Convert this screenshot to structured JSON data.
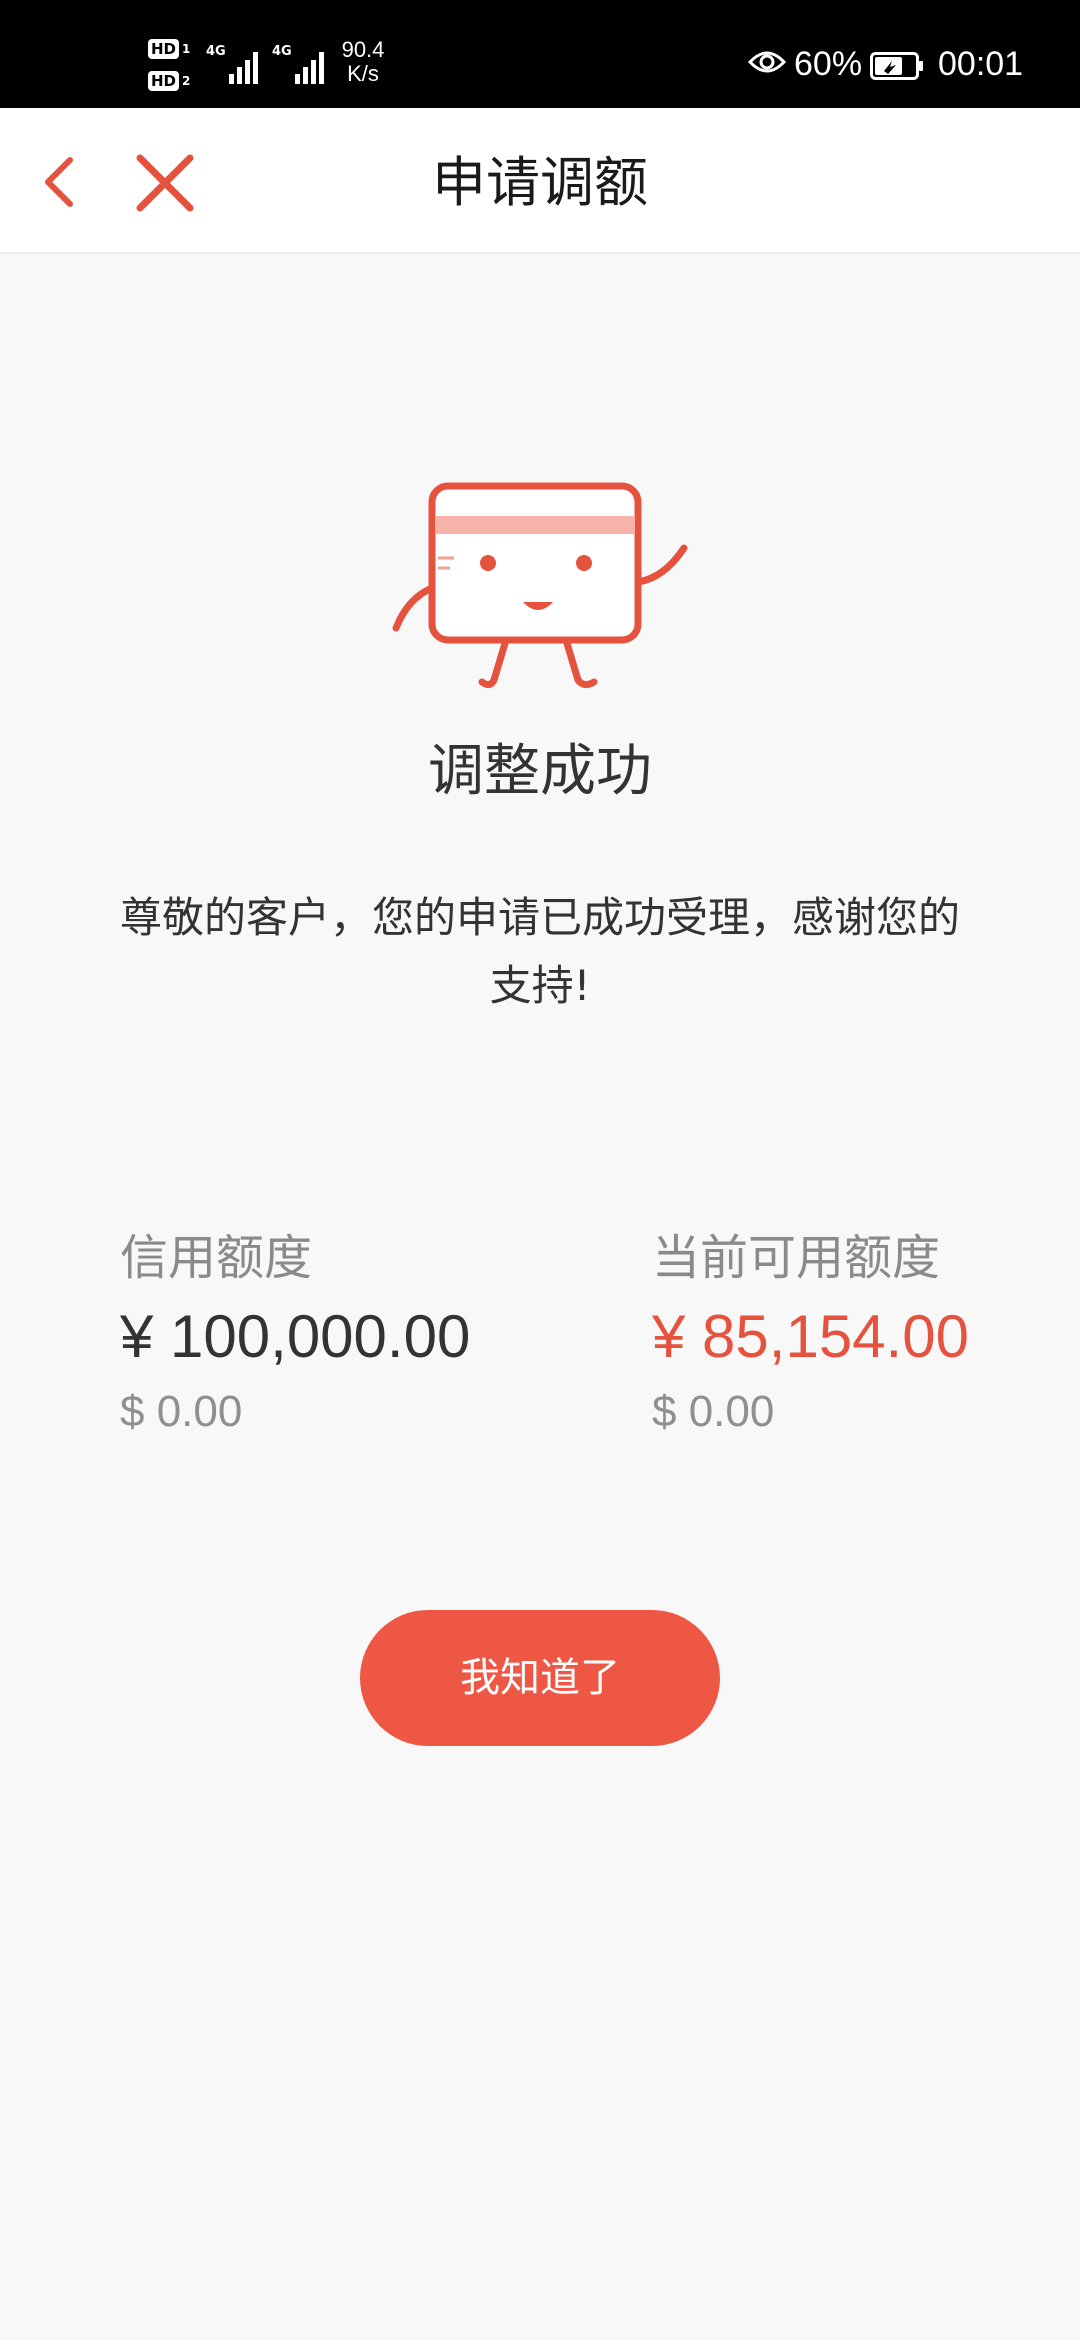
{
  "status_bar": {
    "sim1_badge": "HD",
    "sim1_index": "1",
    "sim2_badge": "HD",
    "sim2_index": "2",
    "network1": "4G",
    "network2": "4G",
    "speed_value": "90.4",
    "speed_unit": "K/s",
    "battery_percent": "60%",
    "time": "00:01",
    "icons": [
      "signal-icon",
      "eye-icon",
      "battery-icon"
    ]
  },
  "nav": {
    "title": "申请调额",
    "back_icon": "chevron-left-icon",
    "close_icon": "close-icon"
  },
  "result": {
    "illustration": "card-mascot-icon",
    "title": "调整成功",
    "message": "尊敬的客户，您的申请已成功受理，感谢您的支持!"
  },
  "limits": {
    "credit": {
      "label": "信用额度",
      "cny": "¥ 100,000.00",
      "usd": "$ 0.00"
    },
    "available": {
      "label": "当前可用额度",
      "cny": "¥ 85,154.00",
      "usd": "$ 0.00"
    }
  },
  "confirm_button": {
    "label": "我知道了"
  },
  "colors": {
    "accent": "#ef5745",
    "accent_text": "#e5533f",
    "page_bg": "#f8f8f8",
    "nav_bg": "#ffffff",
    "status_bar_bg": "#000000"
  }
}
